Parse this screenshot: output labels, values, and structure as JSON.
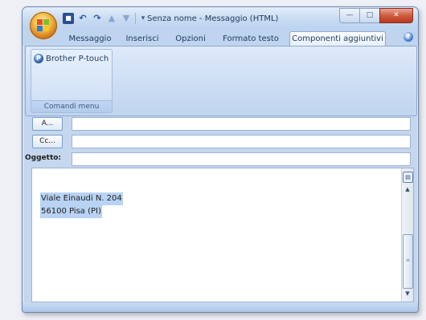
{
  "window": {
    "title": "Senza nome - Messaggio (HTML)"
  },
  "qat": {
    "icons": [
      "save-icon",
      "undo-icon",
      "redo-icon",
      "up-arrow-icon",
      "down-arrow-icon",
      "customize-icon"
    ]
  },
  "tabs": [
    {
      "label": "Messaggio"
    },
    {
      "label": "Inserisci"
    },
    {
      "label": "Opzioni"
    },
    {
      "label": "Formato testo"
    },
    {
      "label": "Componenti aggiuntivi"
    }
  ],
  "ribbon": {
    "active_tab": "Componenti aggiuntivi",
    "group": {
      "button_label": "Brother P-touch",
      "label": "Comandi menu"
    }
  },
  "fields": {
    "to_label": "A...",
    "cc_label": "Cc...",
    "subject_label": "Oggetto:"
  },
  "body": {
    "lines": [
      "Viale Einaudi N. 204",
      "56100 Pisa (PI)"
    ]
  },
  "colors": {
    "accent": "#c5d7ef",
    "selection": "#b8d3f3",
    "close_button": "#cf5a3e"
  }
}
